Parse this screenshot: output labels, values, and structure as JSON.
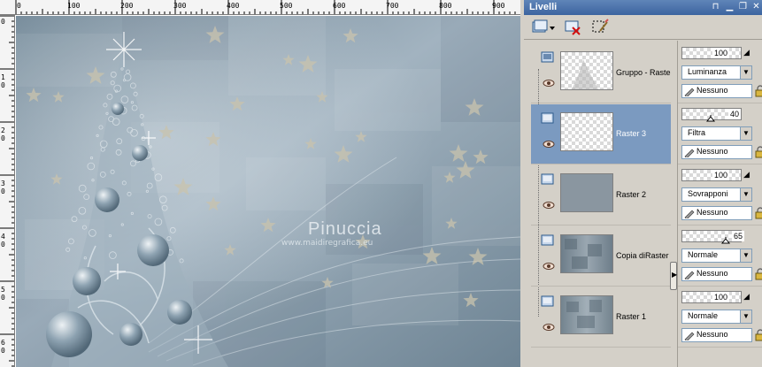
{
  "ruler": {
    "top_labels": [
      "0",
      "100",
      "200",
      "300",
      "400",
      "500",
      "600",
      "700",
      "800",
      "900"
    ],
    "left_labels": [
      "0",
      "1",
      "1\n0",
      "2\n0",
      "3\n0",
      "4\n0",
      "5\n0",
      "6\n0"
    ]
  },
  "artwork": {
    "watermark_name": "Pinuccia",
    "watermark_url": "www.maidiregrafica.eu"
  },
  "palette": {
    "title": "Livelli",
    "titlebar_buttons": [
      "pin-icon",
      "minimize-icon",
      "restore-icon",
      "close-icon"
    ],
    "toolbar": {
      "new_layer_icon": "new-layer-icon",
      "delete_layer_icon": "delete-layer-icon",
      "edit_selection_icon": "edit-selection-icon"
    },
    "layers": [
      {
        "name": "Gruppo - Raster",
        "thumb": "transparent",
        "selected": false,
        "opacity": "100",
        "blend_mode": "Luminanza",
        "mask": "Nessuno"
      },
      {
        "name": "Raster 3",
        "thumb": "transparent",
        "selected": true,
        "opacity": "40",
        "blend_mode": "Filtra",
        "mask": "Nessuno"
      },
      {
        "name": "Raster 2",
        "thumb": "#8a96a0",
        "selected": false,
        "opacity": "100",
        "blend_mode": "Sovrapponi",
        "mask": "Nessuno"
      },
      {
        "name": "Copia diRaster",
        "thumb": "#8a96a0",
        "selected": false,
        "opacity": "65",
        "blend_mode": "Normale",
        "mask": "Nessuno"
      },
      {
        "name": "Raster 1",
        "thumb": "#8a96a0",
        "selected": false,
        "opacity": "100",
        "blend_mode": "Normale",
        "mask": "Nessuno"
      }
    ]
  },
  "colors": {
    "artwork_base": "#7e93a3",
    "selected_row": "#7b9ac0",
    "titlebar": "#3c64a0"
  }
}
